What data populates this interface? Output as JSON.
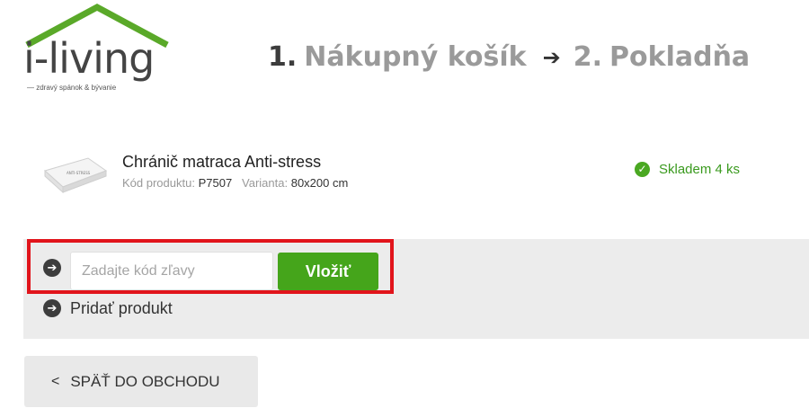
{
  "logo": {
    "text": "i-living",
    "tagline": "— zdravý spánok & bývanie",
    "colors": {
      "roof": "#5aa929",
      "text": "#444444"
    }
  },
  "steps": [
    {
      "number": "1.",
      "label": "Nákupný košík"
    },
    {
      "number": "2.",
      "label": "Pokladňa"
    }
  ],
  "step_arrow": "➔",
  "product": {
    "name": "Chránič matraca Anti-stress",
    "code_label": "Kód produktu:",
    "code": "P7507",
    "variant_label": "Varianta:",
    "variant": "80x200 cm",
    "stock": "Skladem 4 ks",
    "image_label": "ANTI-STRESS"
  },
  "coupon": {
    "placeholder": "Zadajte kód zľavy",
    "value": "",
    "button_label": "Vložiť"
  },
  "add_product_label": "Pridať produkt",
  "back_button_label": "SPÄŤ DO OBCHODU",
  "colors": {
    "accent_green": "#45a51b",
    "highlight_red": "#e1141b",
    "panel_gray": "#ececec"
  }
}
